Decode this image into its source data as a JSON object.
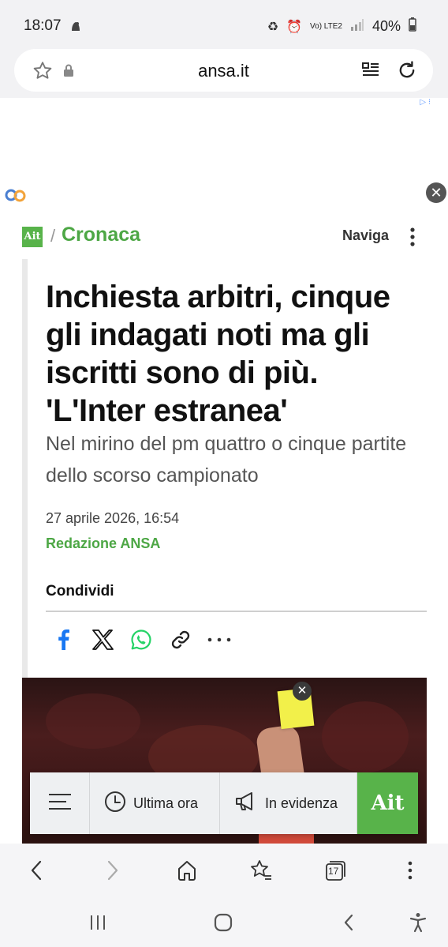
{
  "status_bar": {
    "time": "18:07",
    "network": "Vo) LTE2",
    "battery": "40%"
  },
  "url_bar": {
    "domain": "ansa.it"
  },
  "ad": {
    "badge": "▷ ⁝"
  },
  "section_bar": {
    "logo_text": "Ait",
    "section": "Cronaca",
    "naviga_label": "Naviga"
  },
  "article": {
    "headline": "Inchiesta arbitri, cinque gli indagati noti ma gli iscritti sono di più. 'L'Inter estranea'",
    "subheadline": "Nel mirino del pm quattro o cinque partite dello scorso campionato",
    "date": "27 aprile 2026, 16:54",
    "author": "Redazione ANSA",
    "share_title": "Condividi",
    "share_icons": [
      "facebook-icon",
      "x-icon",
      "whatsapp-icon",
      "link-icon",
      "more-icon"
    ]
  },
  "site_nav": {
    "latest_label": "Ultima ora",
    "highlights_label": "In evidenza",
    "logo_text": "Ait"
  },
  "browser_toolbar": {
    "tabs_count": "17"
  },
  "colors": {
    "brand_green": "#58b34a",
    "section_green": "#4da745"
  }
}
